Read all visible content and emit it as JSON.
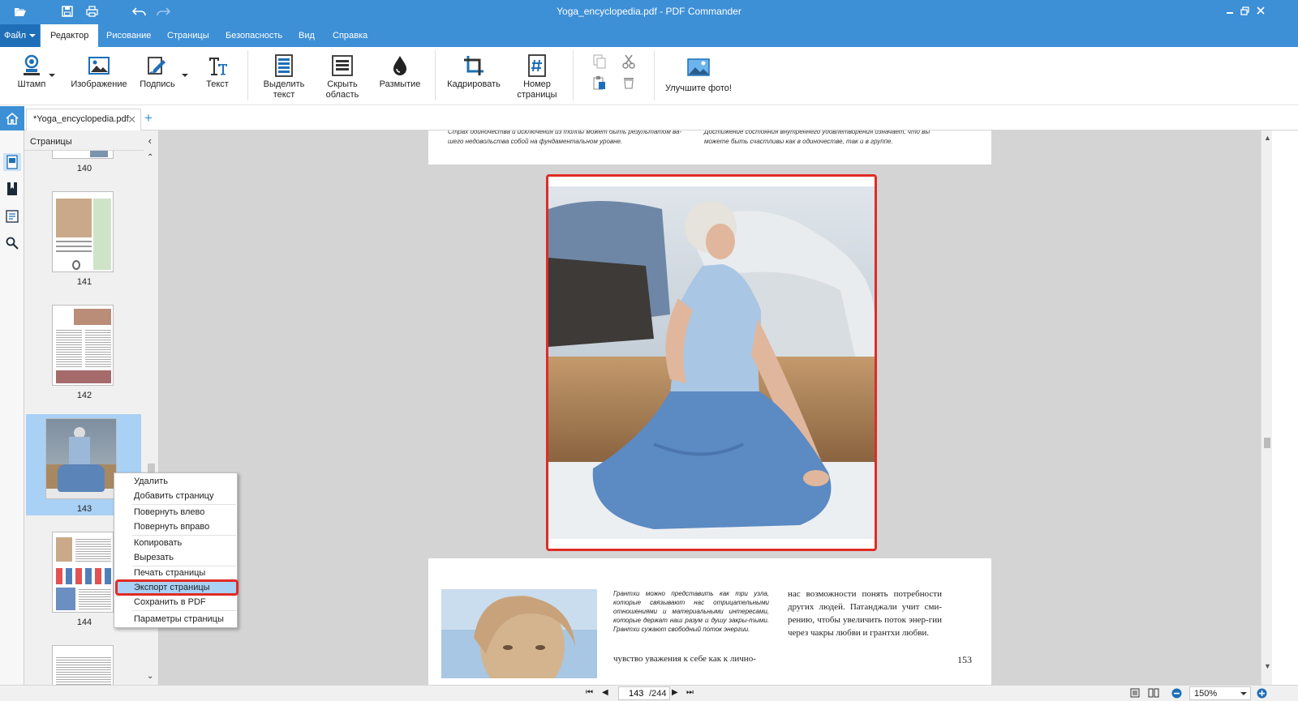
{
  "window": {
    "title": "Yoga_encyclopedia.pdf - PDF Commander",
    "accent": "#3d8fd6",
    "highlight": "#e02b25"
  },
  "menu": {
    "file": "Файл",
    "tabs": [
      "Редактор",
      "Рисование",
      "Страницы",
      "Безопасность",
      "Вид",
      "Справка"
    ],
    "active": "Редактор"
  },
  "ribbon": {
    "stamp": "Штамп",
    "image": "Изображение",
    "signature": "Подпись",
    "text": "Текст",
    "select_text": "Выделить текст",
    "hide_area": "Скрыть область",
    "blur": "Размытие",
    "crop": "Кадрировать",
    "page_number": "Номер страницы",
    "enhance_photo": "Улучшите фото!"
  },
  "doc_tab": {
    "name": "*Yoga_encyclopedia.pdf"
  },
  "pages_panel": {
    "header": "Страницы",
    "thumbs": [
      {
        "num": "140"
      },
      {
        "num": "141"
      },
      {
        "num": "142"
      },
      {
        "num": "143"
      },
      {
        "num": "144"
      }
    ],
    "selected": "143"
  },
  "context_menu": {
    "items": [
      "Удалить",
      "Добавить страницу",
      "Повернуть влево",
      "Повернуть вправо",
      "Копировать",
      "Вырезать",
      "Печать страницы",
      "Экспорт страницы",
      "Сохранить в PDF",
      "Параметры страницы"
    ],
    "highlighted": "Экспорт страницы"
  },
  "document": {
    "top_left_text": "Страх одиночества и исключения из толпы может быть результатом ва-\nшего недовольства собой на фундаментальном уровне.",
    "top_right_text": "Достижение состояния внутреннего удовлетворения означает, что вы\nможете быть счастливы как в одиночестве, так и в группе.",
    "italic_block": "Грантхи можно представить как три узла, которые связывают нас отрицательными отношениями и материальными интересами, которые держат наш разум и душу закры-тыми. Грантхи сужают свободный поток энергии.",
    "col1_text": "чувство уважения к себе как к лично-",
    "col2_text": "нас возможности понять потребности других людей. Патанджали учит сми-рению, чтобы увеличить поток энер-гии через чакры любви и грантхи любви.",
    "page_num": "153"
  },
  "status": {
    "current_page": "143",
    "total_pages": "/244",
    "zoom": "150%"
  }
}
